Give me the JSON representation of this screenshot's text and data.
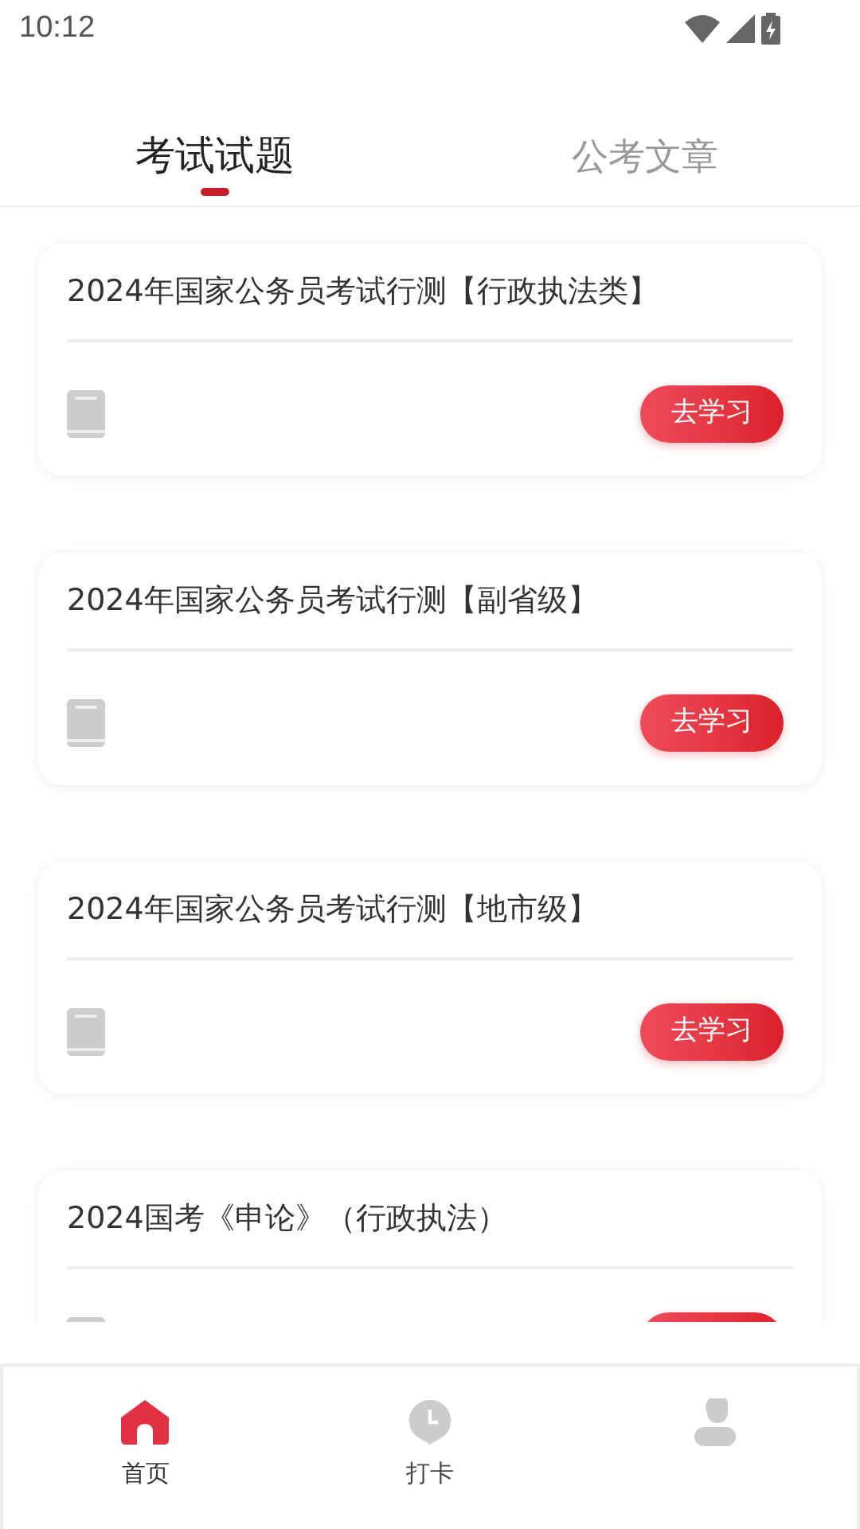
{
  "status_bar": {
    "time": "10:12"
  },
  "tabs": [
    {
      "label": "考试试题",
      "selected": true
    },
    {
      "label": "公考文章",
      "selected": false
    }
  ],
  "cards": [
    {
      "title": "2024年国家公务员考试行测【行政执法类】",
      "button": "去学习"
    },
    {
      "title": "2024年国家公务员考试行测【副省级】",
      "button": "去学习"
    },
    {
      "title": "2024年国家公务员考试行测【地市级】",
      "button": "去学习"
    },
    {
      "title": "2024国考《申论》（行政执法）"
    }
  ],
  "bottom_nav": [
    {
      "kind": "home",
      "label": "首页",
      "selected": true
    },
    {
      "kind": "clock",
      "label": "打卡",
      "selected": false
    },
    {
      "kind": "person",
      "selected": false
    }
  ]
}
